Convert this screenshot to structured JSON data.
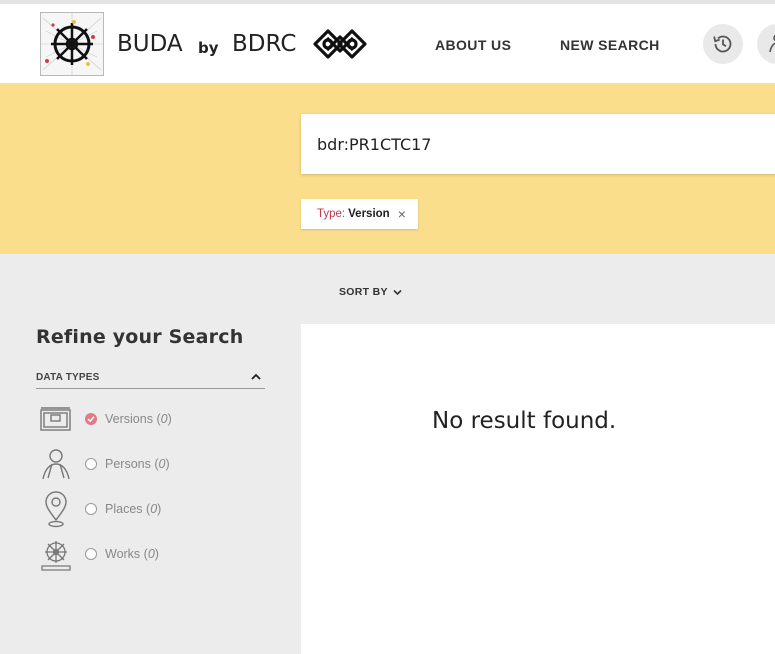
{
  "header": {
    "brand_name": "BUDA",
    "brand_by": "by",
    "brand_org": "BDRC",
    "nav": {
      "about": "ABOUT US",
      "new_search": "NEW SEARCH"
    }
  },
  "search": {
    "query": "bdr:PR1CTC17",
    "filter_chip": {
      "key": "Type:",
      "value": "Version",
      "close": "×"
    }
  },
  "toolbar": {
    "sort_label": "SORT BY"
  },
  "sidebar": {
    "title": "Refine your Search",
    "section_title": "DATA TYPES",
    "facets": [
      {
        "label": "Versions",
        "count": "0",
        "open": "(",
        "close": ")",
        "checked": true
      },
      {
        "label": "Persons",
        "count": "0",
        "open": "(",
        "close": ")",
        "checked": false
      },
      {
        "label": "Places",
        "count": "0",
        "open": "(",
        "close": ")",
        "checked": false
      },
      {
        "label": "Works",
        "count": "0",
        "open": "(",
        "close": ")",
        "checked": false
      }
    ]
  },
  "results": {
    "empty_message": "No result found."
  },
  "colors": {
    "banner": "#fbde8b",
    "accent": "#c2384c",
    "checked": "#e07a86",
    "panel": "#ececec"
  }
}
